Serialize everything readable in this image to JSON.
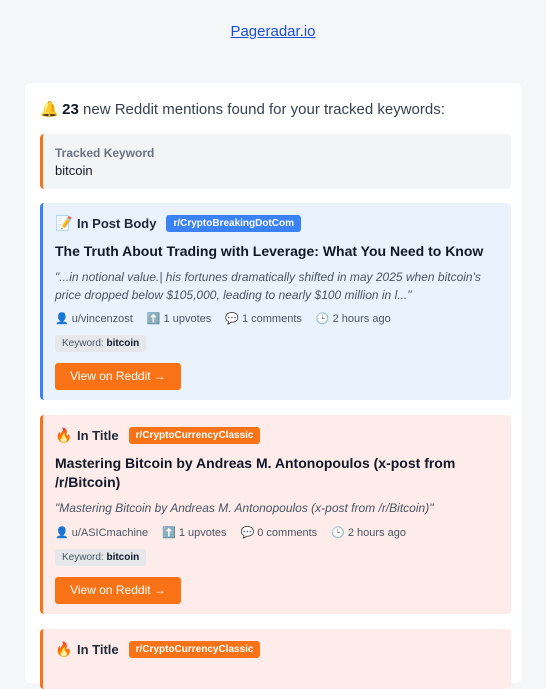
{
  "header": {
    "link": "Pageradar.io"
  },
  "summary": {
    "bell_icon": "🔔",
    "count": "23",
    "text": " new Reddit mentions found for your tracked keywords:"
  },
  "tracked": {
    "label": "Tracked Keyword",
    "value": "bitcoin"
  },
  "mentions": [
    {
      "type_icon": "📝",
      "type": "In Post Body",
      "subreddit": "r/CryptoBreakingDotCom",
      "title": "The Truth About Trading with Leverage: What You Need to Know",
      "snippet": "\"...in notional value.| his fortunes dramatically shifted in may 2025 when bitcoin's price dropped below $105,000, leading to nearly $100 million in l...\"",
      "author": "u/vincenzost",
      "upvotes": "1 upvotes",
      "comments": "1 comments",
      "time": "2 hours ago",
      "keyword_label": "Keyword:",
      "keyword": "bitcoin",
      "button": "View on Reddit →",
      "accent": "#3b82f6"
    },
    {
      "type_icon": "🔥",
      "type": "In Title",
      "subreddit": "r/CryptoCurrencyClassic",
      "title": "Mastering Bitcoin by Andreas M. Antonopoulos (x-post from /r/Bitcoin)",
      "snippet": "\"Mastering Bitcoin by Andreas M. Antonopoulos (x-post from /r/Bitcoin)\"",
      "author": "u/ASICmachine",
      "upvotes": "1 upvotes",
      "comments": "0 comments",
      "time": "2 hours ago",
      "keyword_label": "Keyword:",
      "keyword": "bitcoin",
      "button": "View on Reddit →",
      "accent": "#f97316"
    },
    {
      "type_icon": "🔥",
      "type": "In Title",
      "subreddit": "r/CryptoCurrencyClassic"
    }
  ],
  "icons": {
    "user": "user-icon",
    "upvote": "upvote-icon",
    "comment": "comment-icon",
    "clock": "clock-icon"
  }
}
